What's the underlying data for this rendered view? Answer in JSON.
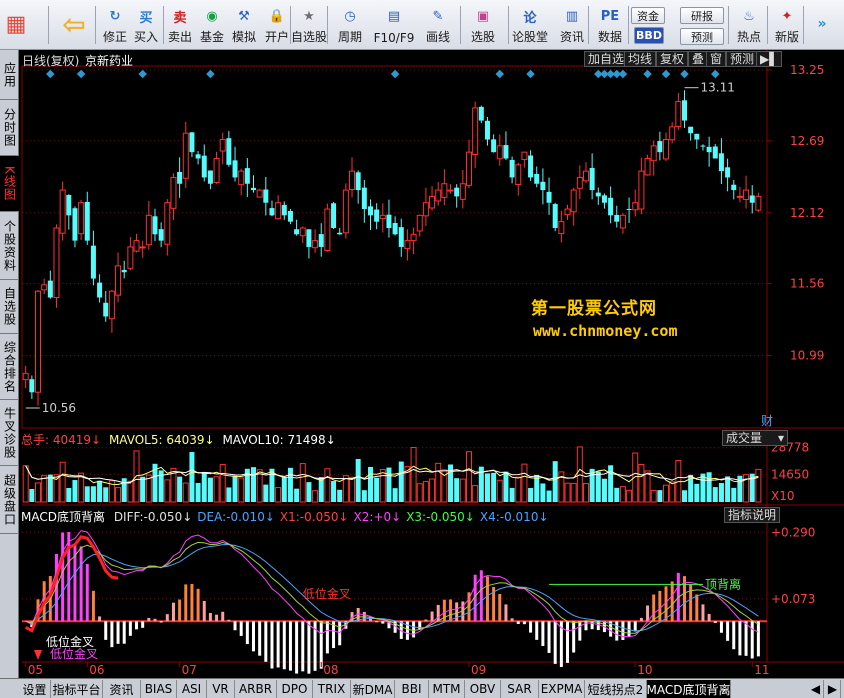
{
  "toolbar": {
    "buttons": [
      {
        "label": "",
        "icon": "grid-icon",
        "name": "menu-button"
      },
      {
        "label": "",
        "icon": "back-arrow-icon",
        "name": "back-button"
      },
      {
        "label": "修正",
        "icon": "refresh-icon",
        "name": "fix-button"
      },
      {
        "label": "买入",
        "icon": "buy-icon",
        "name": "buy-button",
        "glyph": "买"
      },
      {
        "label": "卖出",
        "icon": "sell-icon",
        "name": "sell-button",
        "glyph": "卖"
      },
      {
        "label": "基金",
        "icon": "fund-icon",
        "name": "fund-button"
      },
      {
        "label": "模拟",
        "icon": "hammer-icon",
        "name": "simulate-button"
      },
      {
        "label": "开户",
        "icon": "lock-icon",
        "name": "open-account-button"
      },
      {
        "label": "自选股",
        "icon": "star-icon",
        "name": "watchlist-button"
      },
      {
        "label": "周期",
        "icon": "clock-icon",
        "name": "period-button"
      },
      {
        "label": "F10/F9",
        "icon": "info-icon",
        "name": "f10-button"
      },
      {
        "label": "画线",
        "icon": "pen-icon",
        "name": "draw-button"
      },
      {
        "label": "选股",
        "icon": "monitor-icon",
        "name": "pick-stock-button"
      },
      {
        "label": "论股堂",
        "icon": "discuss-icon",
        "name": "forum-button",
        "glyph": "论"
      },
      {
        "label": "资讯",
        "icon": "news-icon",
        "name": "news-button"
      },
      {
        "label": "数据",
        "icon": "pe-icon",
        "name": "data-button",
        "glyph": "PE"
      },
      {
        "label": "热点",
        "icon": "hot-icon",
        "name": "hot-button"
      },
      {
        "label": "新版",
        "icon": "new-icon",
        "name": "new-version-button"
      },
      {
        "label": "",
        "icon": "expand-icon",
        "name": "expand-button"
      }
    ],
    "mini": {
      "fund": "资金",
      "bbd": "BBD",
      "research": "研报",
      "forecast": "预测"
    }
  },
  "sidebar": {
    "tabs": [
      "应用",
      "分时图",
      "K线图",
      "个股资料",
      "自选股",
      "综合排名",
      "牛叉诊股",
      "超级盘口"
    ],
    "active": 2
  },
  "header": {
    "period": "日线(复权)",
    "stock": "京新药业",
    "buttons": [
      "加自选",
      "均线",
      "复权",
      "叠",
      "窗",
      "预测"
    ],
    "cai": "财"
  },
  "watermark": {
    "line1": "第一股票公式网",
    "line2": "www.chnmoney.com"
  },
  "price_panel": {
    "labels": [
      "13.25",
      "12.69",
      "12.12",
      "11.56",
      "10.99"
    ],
    "high_label": "13.11",
    "low_label": "10.56"
  },
  "volume_panel": {
    "title": "总手:",
    "total": "40419↓",
    "mavol5_label": "MAVOL5:",
    "mavol5": "64039↓",
    "mavol10_label": "MAVOL10:",
    "mavol10": "71498↓",
    "selector": "成交量",
    "labels": [
      "28778",
      "14650",
      "X10"
    ]
  },
  "macd_panel": {
    "name": "MACD底顶背离",
    "items": [
      {
        "k": "DIFF:",
        "v": "-0.050↓",
        "color": "#e0e0e0"
      },
      {
        "k": "DEA:",
        "v": "-0.010↓",
        "color": "#4aa3ff"
      },
      {
        "k": "X1:",
        "v": "-0.050↓",
        "color": "#ff4040"
      },
      {
        "k": "X2:",
        "v": "+0↓",
        "color": "#ff40ff"
      },
      {
        "k": "X3:",
        "v": "-0.050↓",
        "color": "#40ff40"
      },
      {
        "k": "X4:",
        "v": "-0.010↓",
        "color": "#4aa3ff"
      }
    ],
    "explain": "指标说明",
    "labels": [
      "+0.290",
      "+0.073"
    ],
    "annotations": {
      "low_cross1": "低位金叉",
      "low_cross2": "低位金叉",
      "top_div": "顶背离",
      "mid_cross": "低位金叉"
    }
  },
  "xaxis": {
    "labels": [
      "05",
      "06",
      "07",
      "08",
      "09",
      "10",
      "11"
    ]
  },
  "bottom_tabs": [
    "设置",
    "指标平台",
    "资讯",
    "BIAS",
    "ASI",
    "VR",
    "ARBR",
    "DPO",
    "TRIX",
    "新DMA",
    "BBI",
    "MTM",
    "OBV",
    "SAR",
    "EXPMA",
    "短线拐点2",
    "MACD底顶背离"
  ],
  "bottom_active": 16,
  "colors": {
    "up": "#ff3030",
    "down": "#54fcfc",
    "grid": "#8b0000"
  },
  "chart_data": {
    "type": "candlestick",
    "title": "日线(复权) 京新药业",
    "ylim": [
      10.56,
      13.25
    ],
    "x": [
      "05",
      "06",
      "07",
      "08",
      "09",
      "10",
      "11"
    ],
    "price_labels": [
      13.25,
      12.69,
      12.12,
      11.56,
      10.99
    ],
    "high": 13.11,
    "low": 10.56,
    "candles_close": [
      10.85,
      10.7,
      11.5,
      11.55,
      11.45,
      12.0,
      12.3,
      12.1,
      11.9,
      12.2,
      11.9,
      11.6,
      11.45,
      11.3,
      11.5,
      11.7,
      11.65,
      11.85,
      11.9,
      11.85,
      12.1,
      11.95,
      11.9,
      12.2,
      12.4,
      12.35,
      12.75,
      12.6,
      12.55,
      12.4,
      12.35,
      12.55,
      12.7,
      12.5,
      12.4,
      12.45,
      12.35,
      12.3,
      12.3,
      12.2,
      12.1,
      12.2,
      12.1,
      12.05,
      11.95,
      12.0,
      11.85,
      11.9,
      11.85,
      12.15,
      12.0,
      11.95,
      12.3,
      12.45,
      12.3,
      12.15,
      12.1,
      12.05,
      12.1,
      12.0,
      11.95,
      11.85,
      11.9,
      11.95,
      12.1,
      12.2,
      12.25,
      12.3,
      12.35,
      12.3,
      12.25,
      12.35,
      12.6,
      12.95,
      12.85,
      12.7,
      12.6,
      12.65,
      12.55,
      12.4,
      12.5,
      12.6,
      12.4,
      12.35,
      12.3,
      12.2,
      12.0,
      12.05,
      12.15,
      12.3,
      12.4,
      12.45,
      12.3,
      12.25,
      12.2,
      12.1,
      12.05,
      12.1,
      12.15,
      12.2,
      12.45,
      12.55,
      12.65,
      12.6,
      12.7,
      12.8,
      13.0,
      12.85,
      12.75,
      12.7,
      12.65,
      12.6,
      12.55,
      12.45,
      12.4,
      12.3,
      12.25,
      12.3,
      12.2,
      12.25
    ],
    "volume_labels": [
      28778,
      14650
    ],
    "macd_labels": [
      0.29,
      0.073
    ]
  }
}
